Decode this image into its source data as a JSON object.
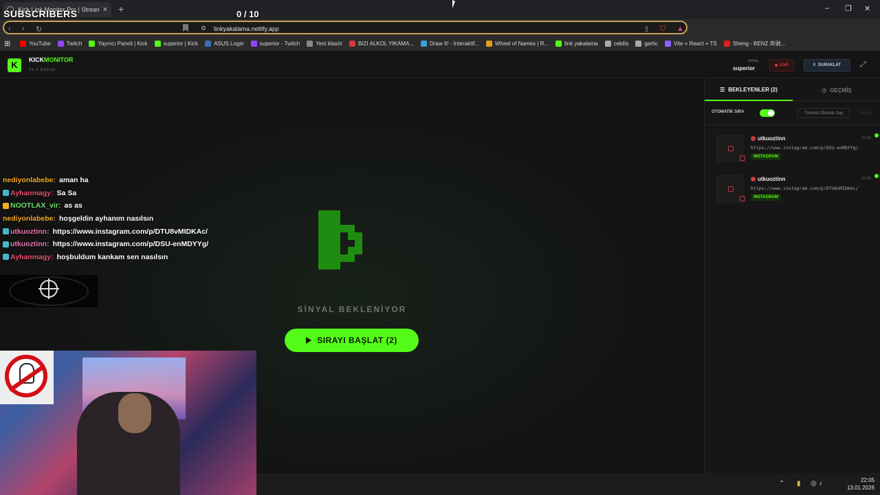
{
  "browser": {
    "tab_title": "Kick Link Monitor Pro | Stream D",
    "url": "linkyakalama.netlify.app",
    "bookmarks": [
      {
        "label": "YouTube",
        "color": "#ff0000"
      },
      {
        "label": "Twitch",
        "color": "#9146ff"
      },
      {
        "label": "Yayıncı Paneli | Kick",
        "color": "#53fc18"
      },
      {
        "label": "superior | Kick",
        "color": "#53fc18"
      },
      {
        "label": "ASUS Login",
        "color": "#3b6fb0"
      },
      {
        "label": "superior - Twitch",
        "color": "#9146ff"
      },
      {
        "label": "Yeni klasör",
        "color": "#888888"
      },
      {
        "label": "BIZI ALKOL YIKAMA...",
        "color": "#d23a3a"
      },
      {
        "label": "Draw It! - İnteraktif...",
        "color": "#3aa0d2"
      },
      {
        "label": "Wheel of Names | R...",
        "color": "#e0a020"
      },
      {
        "label": "link yakalama",
        "color": "#53fc18"
      },
      {
        "label": "cekilis",
        "color": "#aaaaaa"
      },
      {
        "label": "gartic",
        "color": "#aaaaaa"
      },
      {
        "label": "Vite + React + TS",
        "color": "#8a63ff"
      },
      {
        "label": "Sheng - BENZ 奔驰...",
        "color": "#e02020"
      }
    ]
  },
  "overlay": {
    "subscribers_label": "SUBSCRIBERS",
    "sub_count": "0 / 10"
  },
  "app": {
    "logo_letter": "K",
    "brand_white": "KICK",
    "brand_green": "MONITOR",
    "version": "V3.0 QUEUE",
    "kanal_label": "KANAL",
    "kanal_value": "superior",
    "live_label": "LIVE",
    "pause_label": "DURAKLAT",
    "signal_text": "SİNYAL BEKLENİYOR",
    "start_button": "SIRAYI BAŞLAT (2)",
    "accent": "#53fc18"
  },
  "chat": [
    {
      "user": "nediyonlabebe:",
      "msg": "aman ha",
      "user_color": "#f5a623",
      "badge": ""
    },
    {
      "user": "Ayhanmagy:",
      "msg": "Sa Sa",
      "user_color": "#e94f6a",
      "badge": "#45b6c9"
    },
    {
      "user": "NOOTLAX_vir:",
      "msg": "as as",
      "user_color": "#6fe06f",
      "badge": "#f0b020"
    },
    {
      "user": "nediyonlabebe:",
      "msg": "hoşgeldin ayhanım nasılsın",
      "user_color": "#f5a623",
      "badge": ""
    },
    {
      "user": "utkuoztinn:",
      "msg": "https://www.instagram.com/p/DTU8vMIDKAc/",
      "user_color": "#e97ab0",
      "badge": "#45b6c9"
    },
    {
      "user": "utkuoztinn:",
      "msg": "https://www.instagram.com/p/DSU-enMDYYg/",
      "user_color": "#e97ab0",
      "badge": "#45b6c9"
    },
    {
      "user": "Ayhanmagy:",
      "msg": "hoşbuldum kankam sen nasılsın",
      "user_color": "#e94f6a",
      "badge": "#45b6c9"
    }
  ],
  "side": {
    "tab_waiting": "BEKLEYENLER (2)",
    "tab_history": "GEÇMİŞ",
    "auto_label": "OTOMATİK SIRA",
    "mark_all": "Tümünü Okundu Say",
    "clear": "Temizle",
    "queue": [
      {
        "user": "utkuoztinn",
        "time": "22:05",
        "link": "https://www.instagram.com/p/DSU-enMDYYg/",
        "platform": "INSTAGRAM"
      },
      {
        "user": "utkuoztinn",
        "time": "22:05",
        "link": "https://www.instagram.com/p/DTU8vMIDKAc/",
        "platform": "INSTAGRAM"
      }
    ]
  },
  "taskbar": {
    "time": "22:05",
    "date": "13.01.2026"
  }
}
